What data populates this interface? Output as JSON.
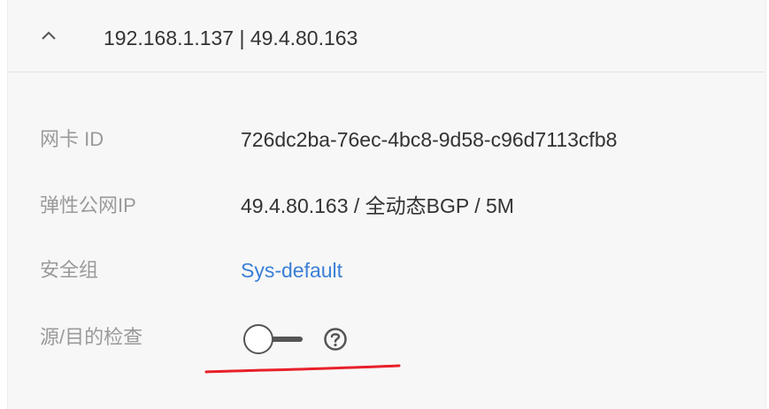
{
  "header": {
    "title": "192.168.1.137 | 49.4.80.163",
    "chevron_icon": "chevron-up-icon"
  },
  "details": {
    "nic_id": {
      "label": "网卡 ID",
      "value": "726dc2ba-76ec-4bc8-9d58-c96d7113cfb8"
    },
    "eip": {
      "label": "弹性公网IP",
      "value": "49.4.80.163 / 全动态BGP / 5M"
    },
    "security_group": {
      "label": "安全组",
      "value": "Sys-default"
    },
    "src_dst_check": {
      "label": "源/目的检查",
      "enabled": false,
      "help_icon": "question-circle-icon"
    }
  },
  "annotation": {
    "color": "#e8202a"
  },
  "colors": {
    "link": "#3a7fd6",
    "label": "#9a9a9a",
    "text": "#333333"
  }
}
